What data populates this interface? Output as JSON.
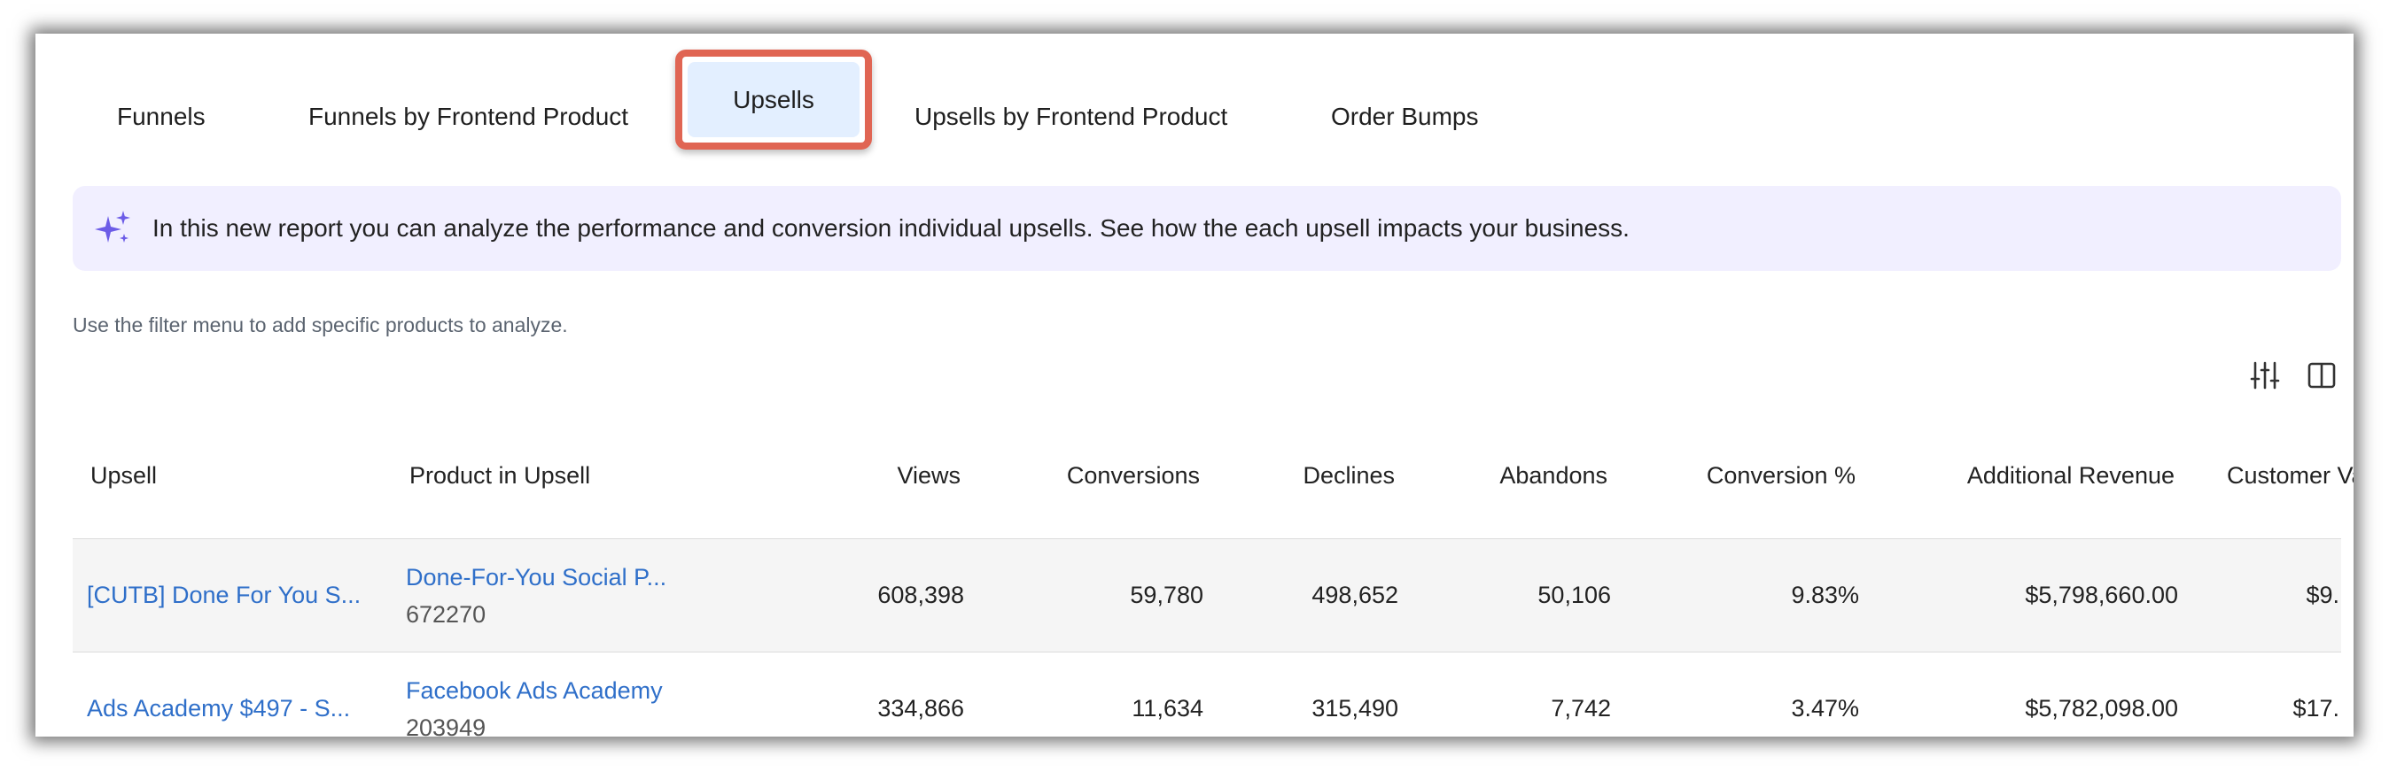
{
  "tabs": [
    {
      "label": "Funnels"
    },
    {
      "label": "Funnels by Frontend Product"
    },
    {
      "label": "Upsells",
      "active": true
    },
    {
      "label": "Upsells by Frontend Product"
    },
    {
      "label": "Order Bumps"
    }
  ],
  "banner": {
    "icon": "sparkle-icon",
    "text": "In this new report you can analyze the performance and conversion individual upsells. See how the each upsell impacts your business."
  },
  "hint": "Use the filter menu to add specific products to analyze.",
  "toolbar": {
    "filter_icon": "filter-sliders-icon",
    "columns_icon": "column-layout-icon"
  },
  "colors": {
    "accent": "#2f6fc9",
    "active_tab_bg": "#e3efff",
    "highlight": "#e06553",
    "banner_bg": "#f1efff"
  },
  "table": {
    "headers": [
      "Upsell",
      "Product in Upsell",
      "Views",
      "Conversions",
      "Declines",
      "Abandons",
      "Conversion %",
      "Additional Revenue",
      "Customer Val"
    ],
    "rows": [
      {
        "upsell": "[CUTB] Done For You S...",
        "product": "Done-For-You Social P...",
        "product_id": "672270",
        "views": "608,398",
        "conversions": "59,780",
        "declines": "498,652",
        "abandons": "50,106",
        "conversion_pct": "9.83%",
        "additional_revenue": "$5,798,660.00",
        "customer_val": "$9."
      },
      {
        "upsell": "Ads Academy $497 - S...",
        "product": "Facebook Ads Academy",
        "product_id": "203949",
        "views": "334,866",
        "conversions": "11,634",
        "declines": "315,490",
        "abandons": "7,742",
        "conversion_pct": "3.47%",
        "additional_revenue": "$5,782,098.00",
        "customer_val": "$17."
      }
    ]
  }
}
